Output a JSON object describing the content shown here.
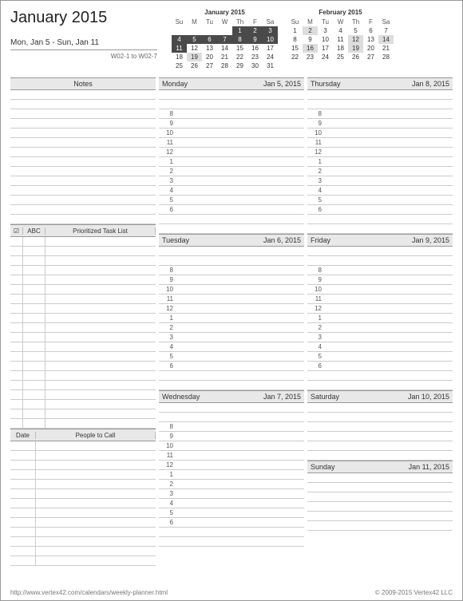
{
  "header": {
    "title": "January 2015",
    "date_range": "Mon, Jan 5  -  Sun, Jan 11",
    "week_range": "W02-1 to W02-7"
  },
  "mini_cals": [
    {
      "title": "January 2015",
      "dow": [
        "Su",
        "M",
        "Tu",
        "W",
        "Th",
        "F",
        "Sa"
      ],
      "rows": [
        [
          {
            "v": ""
          },
          {
            "v": ""
          },
          {
            "v": ""
          },
          {
            "v": ""
          },
          {
            "v": "1",
            "c": "hl"
          },
          {
            "v": "2",
            "c": "hl"
          },
          {
            "v": "3",
            "c": "hl"
          }
        ],
        [
          {
            "v": "4",
            "c": "hl"
          },
          {
            "v": "5",
            "c": "hl"
          },
          {
            "v": "6",
            "c": "hl"
          },
          {
            "v": "7",
            "c": "hl"
          },
          {
            "v": "8",
            "c": "hl"
          },
          {
            "v": "9",
            "c": "hl"
          },
          {
            "v": "10",
            "c": "hl"
          }
        ],
        [
          {
            "v": "11",
            "c": "hl"
          },
          {
            "v": "12"
          },
          {
            "v": "13"
          },
          {
            "v": "14"
          },
          {
            "v": "15"
          },
          {
            "v": "16"
          },
          {
            "v": "17"
          }
        ],
        [
          {
            "v": "18"
          },
          {
            "v": "19",
            "c": "gr"
          },
          {
            "v": "20"
          },
          {
            "v": "21"
          },
          {
            "v": "22"
          },
          {
            "v": "23"
          },
          {
            "v": "24"
          }
        ],
        [
          {
            "v": "25"
          },
          {
            "v": "26"
          },
          {
            "v": "27"
          },
          {
            "v": "28"
          },
          {
            "v": "29"
          },
          {
            "v": "30"
          },
          {
            "v": "31"
          }
        ]
      ]
    },
    {
      "title": "February 2015",
      "dow": [
        "Su",
        "M",
        "Tu",
        "W",
        "Th",
        "F",
        "Sa"
      ],
      "rows": [
        [
          {
            "v": "1"
          },
          {
            "v": "2",
            "c": "gr"
          },
          {
            "v": "3"
          },
          {
            "v": "4"
          },
          {
            "v": "5"
          },
          {
            "v": "6"
          },
          {
            "v": "7"
          }
        ],
        [
          {
            "v": "8"
          },
          {
            "v": "9"
          },
          {
            "v": "10"
          },
          {
            "v": "11"
          },
          {
            "v": "12",
            "c": "gr"
          },
          {
            "v": "13"
          },
          {
            "v": "14",
            "c": "gr"
          }
        ],
        [
          {
            "v": "15"
          },
          {
            "v": "16",
            "c": "gr"
          },
          {
            "v": "17"
          },
          {
            "v": "18"
          },
          {
            "v": "19",
            "c": "gr"
          },
          {
            "v": "20"
          },
          {
            "v": "21"
          }
        ],
        [
          {
            "v": "22"
          },
          {
            "v": "23"
          },
          {
            "v": "24"
          },
          {
            "v": "25"
          },
          {
            "v": "26"
          },
          {
            "v": "27"
          },
          {
            "v": "28"
          }
        ],
        [
          {
            "v": ""
          },
          {
            "v": ""
          },
          {
            "v": ""
          },
          {
            "v": ""
          },
          {
            "v": ""
          },
          {
            "v": ""
          },
          {
            "v": ""
          }
        ]
      ]
    }
  ],
  "sections": {
    "notes": "Notes",
    "task_label": "Prioritized Task List",
    "task_cols": {
      "check": "☑",
      "abc": "ABC"
    },
    "people_label": "People to Call",
    "people_date": "Date"
  },
  "days": [
    {
      "name": "Monday",
      "date": "Jan 5, 2015"
    },
    {
      "name": "Tuesday",
      "date": "Jan 6, 2015"
    },
    {
      "name": "Wednesday",
      "date": "Jan 7, 2015"
    },
    {
      "name": "Thursday",
      "date": "Jan 8, 2015"
    },
    {
      "name": "Friday",
      "date": "Jan 9, 2015"
    },
    {
      "name": "Saturday",
      "date": "Jan 10, 2015"
    },
    {
      "name": "Sunday",
      "date": "Jan 11, 2015"
    }
  ],
  "hours": [
    "8",
    "9",
    "10",
    "11",
    "12",
    "1",
    "2",
    "3",
    "4",
    "5",
    "6"
  ],
  "footer": {
    "url": "http://www.vertex42.com/calendars/weekly-planner.html",
    "copyright": "© 2009-2015 Vertex42 LLC"
  }
}
